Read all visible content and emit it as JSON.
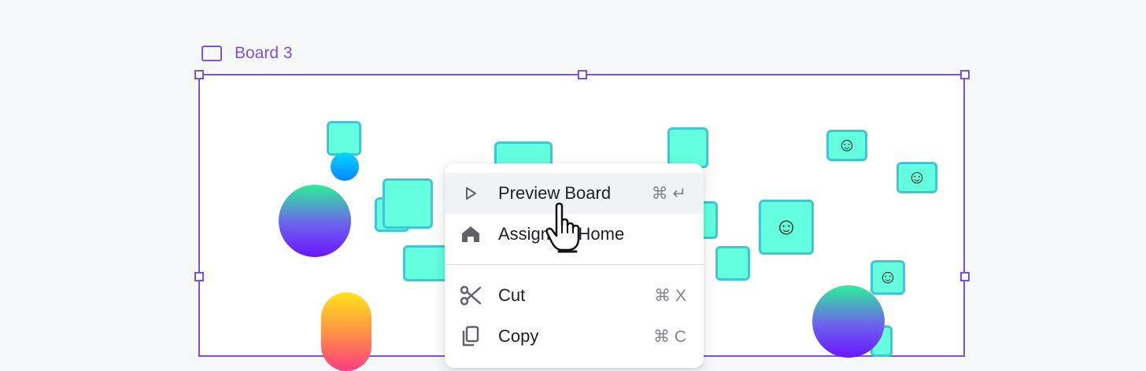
{
  "board": {
    "icon": "frame-icon",
    "label": "Board 3",
    "accent_color": "#7b4fe9",
    "tile_color": "#63ffde",
    "tile_border_color": "#3ec8d4"
  },
  "canvas": {
    "tiles": [
      {
        "glyph": ""
      },
      {
        "glyph": ""
      },
      {
        "glyph": ""
      },
      {
        "glyph": ""
      },
      {
        "glyph": ""
      },
      {
        "glyph": ""
      },
      {
        "glyph": ""
      },
      {
        "glyph": ""
      },
      {
        "glyph": "☺"
      },
      {
        "glyph": "☺"
      },
      {
        "glyph": "☺"
      },
      {
        "glyph": "☺"
      },
      {
        "glyph": ""
      }
    ]
  },
  "context_menu": {
    "items": [
      {
        "icon": "play-icon",
        "label": "Preview Board",
        "shortcut": "⌘ ↵",
        "highlighted": true
      },
      {
        "icon": "home-icon",
        "label": "Assign as Home",
        "shortcut": ""
      },
      {
        "icon": "scissors-icon",
        "label": "Cut",
        "shortcut": "⌘ X"
      },
      {
        "icon": "copy-icon",
        "label": "Copy",
        "shortcut": "⌘ C"
      }
    ]
  },
  "cursor": {
    "icon": "hand-pointer-icon"
  }
}
